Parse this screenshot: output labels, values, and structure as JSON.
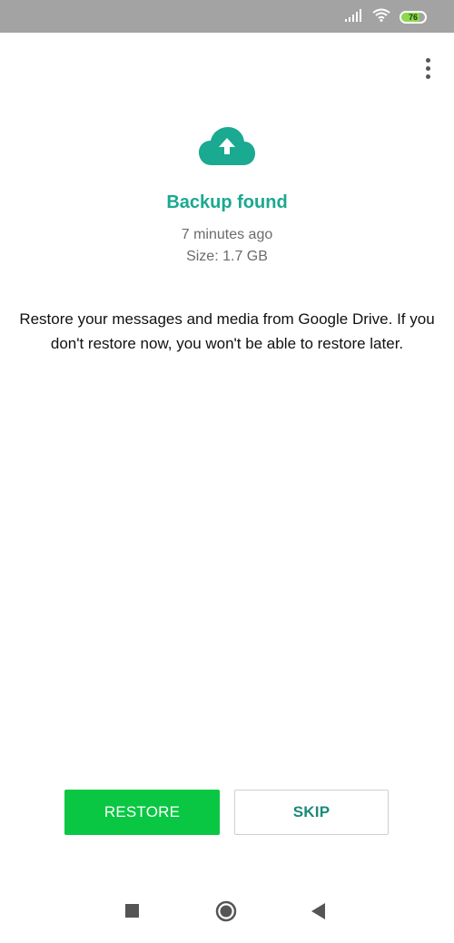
{
  "status_bar": {
    "battery_level": "76",
    "battery_fill_fraction": 0.76,
    "icons": [
      "signal-icon",
      "wifi-icon",
      "battery-icon"
    ]
  },
  "menu": {
    "icon": "more-vert-icon"
  },
  "backup": {
    "icon": "cloud-upload-icon",
    "title": "Backup found",
    "time": "7 minutes ago",
    "size": "Size: 1.7 GB",
    "description": "Restore your messages and media from Google Drive. If you don't restore now, you won't be able to restore later."
  },
  "actions": {
    "restore_label": "RESTORE",
    "skip_label": "SKIP"
  },
  "nav_bar": {
    "icons": [
      "recents-icon",
      "home-icon",
      "back-icon"
    ]
  },
  "colors": {
    "accent_teal": "#1aa991",
    "restore_green": "#09c742",
    "status_bar_gray": "#a3a3a3"
  }
}
